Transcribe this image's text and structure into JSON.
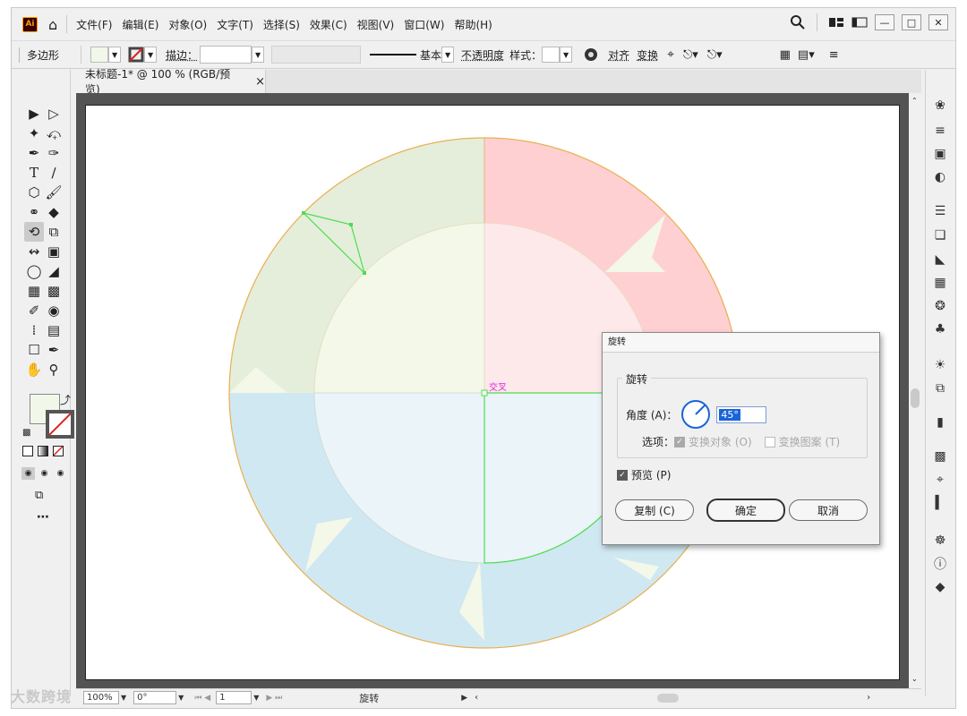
{
  "app": {
    "logo": "Ai"
  },
  "menu": [
    "文件(F)",
    "编辑(E)",
    "对象(O)",
    "文字(T)",
    "选择(S)",
    "效果(C)",
    "视图(V)",
    "窗口(W)",
    "帮助(H)"
  ],
  "control_bar": {
    "object_type": "多边形",
    "stroke_label": "描边：",
    "stroke_style": "基本",
    "opacity_label": "不透明度",
    "style_label": "样式：",
    "align_label": "对齐",
    "transform_label": "变换"
  },
  "tab": {
    "title": "未标题-1* @ 100 % (RGB/预览)",
    "close": "×"
  },
  "canvas": {
    "cross_label": "交叉"
  },
  "dialog": {
    "title": "旋转",
    "group_label": "旋转",
    "angle_label": "角度 (A)：",
    "angle_value": "45°",
    "options_label": "选项：",
    "transform_objects": "变换对象 (O)",
    "transform_patterns": "变换图案 (T)",
    "preview_label": "预览 (P)",
    "copy_button": "复制 (C)",
    "ok_button": "确定",
    "cancel_button": "取消"
  },
  "status": {
    "zoom": "100%",
    "rotation": "0°",
    "page": "1",
    "tool": "旋转"
  },
  "watermark": "大数跨境",
  "colors": {
    "green_segment": "#e5eedb",
    "red_segment": "#ffd0d2",
    "blue_segment": "#d0e8f2",
    "inner_green": "#f3f8e9",
    "inner_red": "#fde8ea",
    "inner_blue": "#ebf4f8",
    "outer_stroke": "#e8b050",
    "selection": "#4ddd4d"
  }
}
